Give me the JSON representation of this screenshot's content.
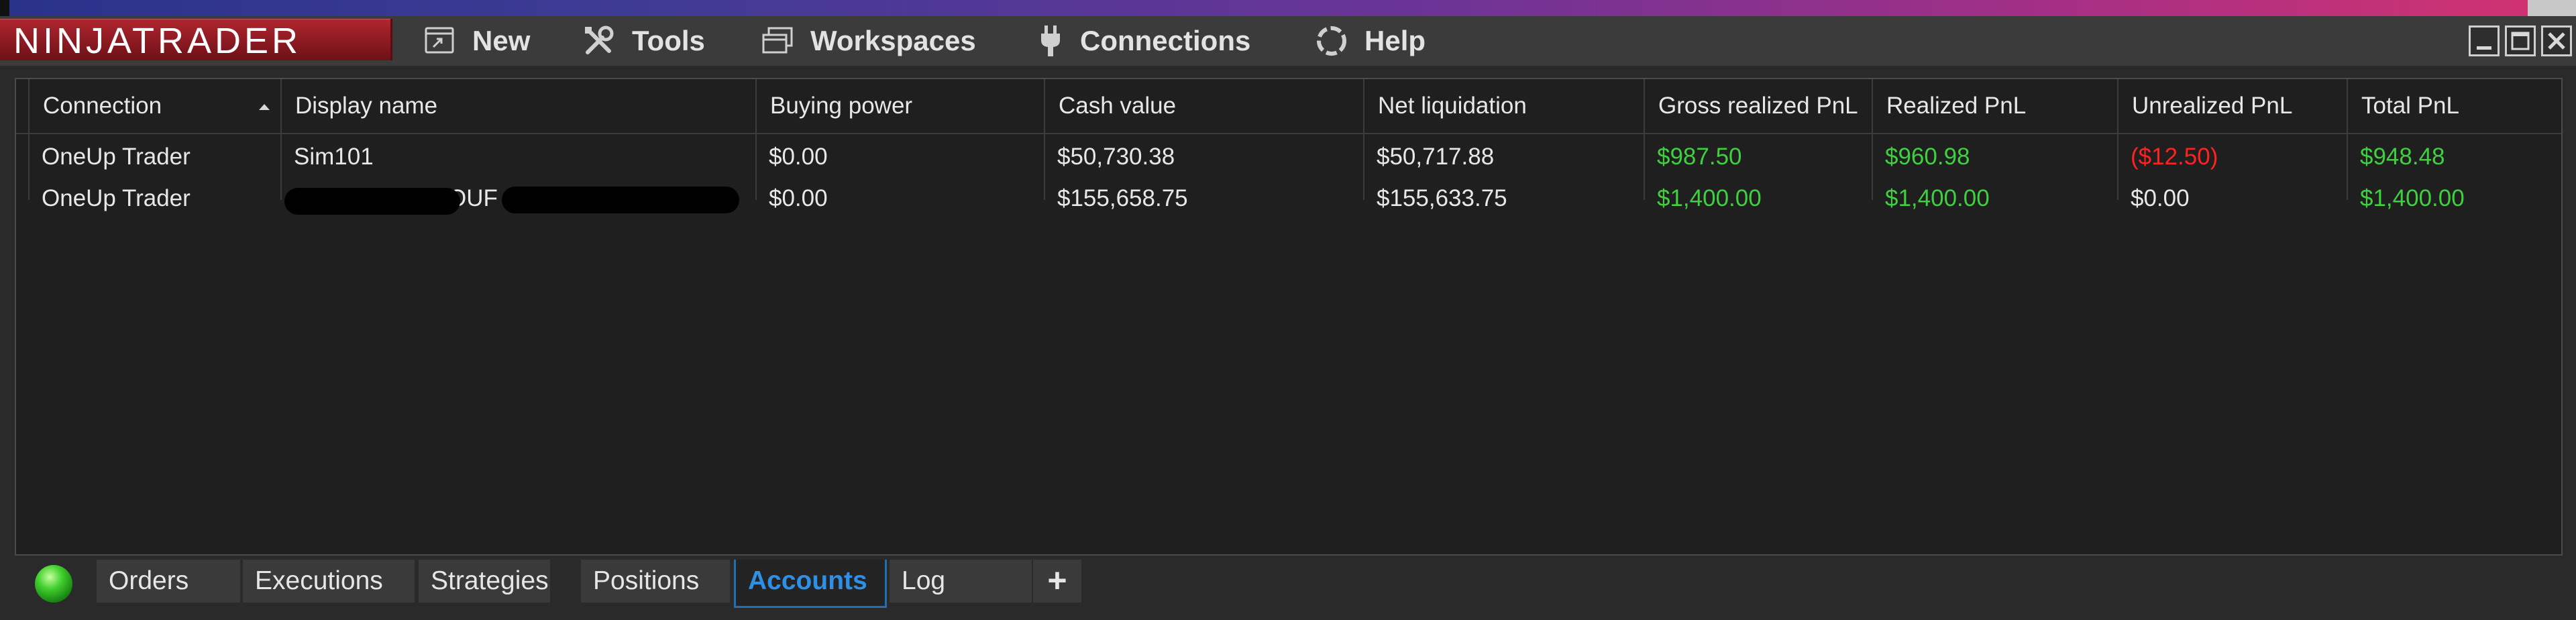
{
  "app": {
    "logo_text": "NINJATRADER"
  },
  "menu": {
    "items": [
      {
        "label": "New"
      },
      {
        "label": "Tools"
      },
      {
        "label": "Workspaces"
      },
      {
        "label": "Connections"
      },
      {
        "label": "Help"
      }
    ]
  },
  "grid": {
    "sort_column": "Connection",
    "sort_direction": "ascending",
    "columns": [
      "Connection",
      "Display name",
      "Buying power",
      "Cash value",
      "Net liquidation",
      "Gross realized PnL",
      "Realized PnL",
      "Unrealized PnL",
      "Total PnL"
    ],
    "rows": [
      {
        "connection": "OneUp Trader",
        "display_name": "Sim101",
        "buying_power": "$0.00",
        "cash_value": "$50,730.38",
        "net_liquidation": "$50,717.88",
        "gross_realized_pnl": "$987.50",
        "realized_pnl": "$960.98",
        "unrealized_pnl": "($12.50)",
        "total_pnl": "$948.48"
      },
      {
        "connection": "OneUp Trader",
        "display_name_visible": "OUF",
        "buying_power": "$0.00",
        "cash_value": "$155,658.75",
        "net_liquidation": "$155,633.75",
        "gross_realized_pnl": "$1,400.00",
        "realized_pnl": "$1,400.00",
        "unrealized_pnl": "$0.00",
        "total_pnl": "$1,400.00"
      }
    ]
  },
  "colors": {
    "positive": "#3fd03f",
    "negative": "#ff2222",
    "active_tab": "#2e8fe6",
    "logo_bg": "#a3222b"
  },
  "tabs": {
    "items": [
      {
        "label": "Orders"
      },
      {
        "label": "Executions"
      },
      {
        "label": "Strategies"
      },
      {
        "label": "Positions"
      },
      {
        "label": "Accounts"
      },
      {
        "label": "Log"
      }
    ],
    "active": "Accounts",
    "add_label": "+"
  }
}
